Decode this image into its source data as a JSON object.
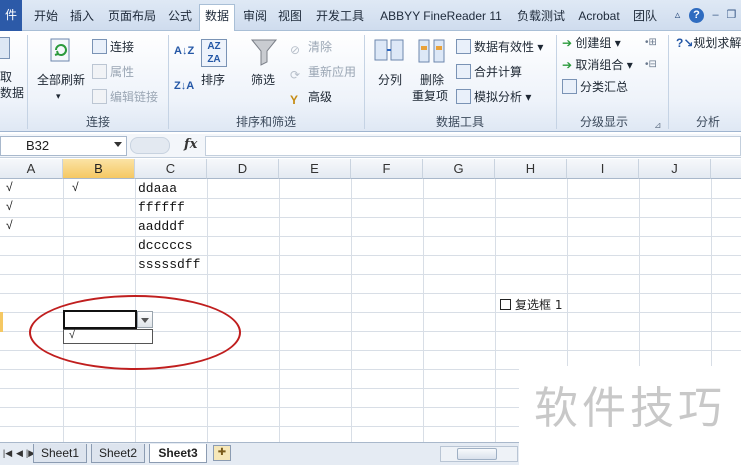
{
  "tabs": {
    "file": "件",
    "items": [
      "开始",
      "插入",
      "页面布局",
      "公式",
      "数据",
      "审阅",
      "视图",
      "开发工具",
      "ABBYY FineReader 11",
      "负载测试",
      "Acrobat",
      "团队"
    ],
    "active": "数据"
  },
  "ribbon": {
    "get_external": [
      "取",
      "数据"
    ],
    "connections": {
      "refresh_all": "全部刷新",
      "connections": "连接",
      "properties": "属性",
      "edit_links": "编辑链接",
      "label": "连接"
    },
    "sort_filter": {
      "sort": "排序",
      "filter": "筛选",
      "clear": "清除",
      "reapply": "重新应用",
      "advanced": "高级",
      "label": "排序和筛选"
    },
    "data_tools": {
      "text_to_columns": "分列",
      "remove_duplicates": [
        "删除",
        "重复项"
      ],
      "data_validation": "数据有效性",
      "consolidate": "合并计算",
      "what_if": "模拟分析",
      "label": "数据工具"
    },
    "outline": {
      "group": "创建组",
      "ungroup": "取消组合",
      "subtotal": "分类汇总",
      "label": "分级显示"
    },
    "analysis": {
      "solver": "规划求解",
      "label": "分析"
    }
  },
  "formula_bar": {
    "name_box": "B32",
    "fx": "fx",
    "formula": ""
  },
  "grid": {
    "columns": [
      "A",
      "B",
      "C",
      "D",
      "E",
      "F",
      "G",
      "H",
      "I",
      "J"
    ],
    "selected_column": "B",
    "cells_c": [
      "ddaaa",
      "ffffff",
      "aadddf",
      "dcccccs",
      "sssssdff"
    ],
    "checkmarks": [
      "√",
      "√",
      "√",
      "√"
    ],
    "dropdown_item": "√",
    "checkbox_label": "复选框 1"
  },
  "sheets": {
    "tabs": [
      "Sheet1",
      "Sheet2",
      "Sheet3"
    ],
    "active": "Sheet3"
  },
  "watermark": "软件技巧"
}
